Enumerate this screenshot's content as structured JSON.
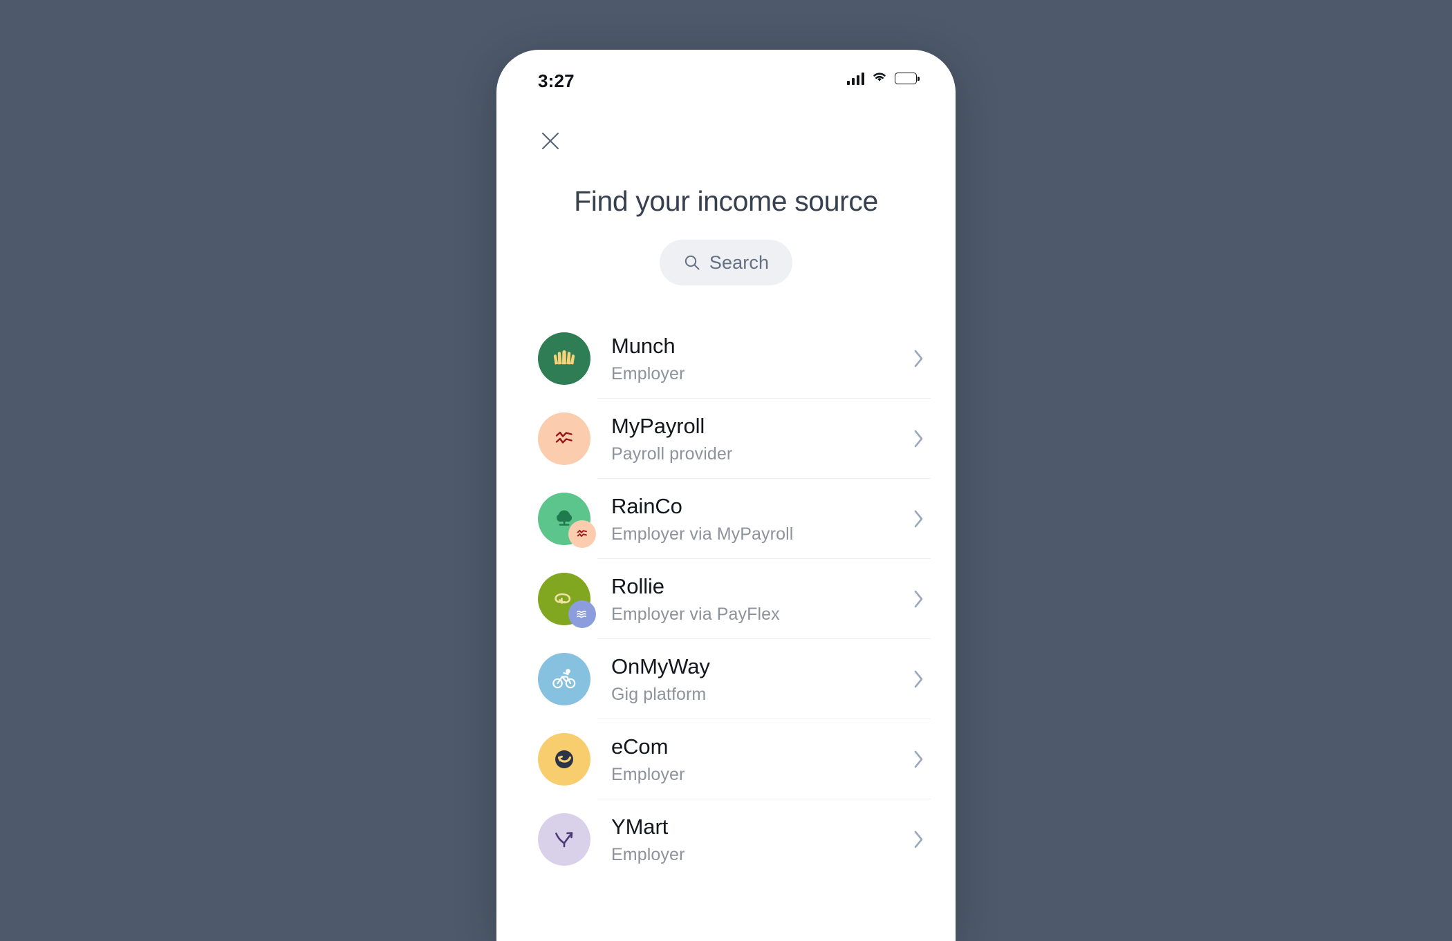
{
  "theme": {
    "backdrop": "#4e5a6b",
    "screen_bg": "#ffffff",
    "title_color": "#37404f",
    "search_bg": "#eef0f3",
    "chevron_color": "#9aa7bd",
    "divider": "#edeef1",
    "subtitle_color": "#8d929b"
  },
  "status_bar": {
    "time": "3:27",
    "signal_icon": "cellular-signal-icon",
    "wifi_icon": "wifi-icon",
    "battery_icon": "battery-full-icon"
  },
  "header": {
    "close_icon": "close-icon",
    "title": "Find your income source"
  },
  "search": {
    "icon": "search-icon",
    "placeholder": "Search",
    "value": ""
  },
  "list": {
    "chevron_icon": "chevron-right-icon",
    "items": [
      {
        "name": "Munch",
        "subtitle": "Employer",
        "icon": "munch-fan-icon",
        "avatar_bg": "#2f7d54",
        "glyph_color": "#f6d278",
        "badge": null
      },
      {
        "name": "MyPayroll",
        "subtitle": "Payroll provider",
        "icon": "mypayroll-zigzag-icon",
        "avatar_bg": "#fbcdae",
        "glyph_color": "#9b1418",
        "badge": null
      },
      {
        "name": "RainCo",
        "subtitle": "Employer via MyPayroll",
        "icon": "rainco-tree-icon",
        "avatar_bg": "#5cc58c",
        "glyph_color": "#1f7a4d",
        "badge": {
          "icon": "mypayroll-zigzag-icon",
          "bg": "#fbcdae",
          "glyph_color": "#9b1418"
        }
      },
      {
        "name": "Rollie",
        "subtitle": "Employer via PayFlex",
        "icon": "rollie-loop-arrow-icon",
        "avatar_bg": "#81a61f",
        "glyph_color": "#f1e2a6",
        "badge": {
          "icon": "payflex-waves-icon",
          "bg": "#8b9ddd",
          "glyph_color": "#ffffff"
        }
      },
      {
        "name": "OnMyWay",
        "subtitle": "Gig platform",
        "icon": "onmyway-cyclist-icon",
        "avatar_bg": "#86c1df",
        "glyph_color": "#ffffff",
        "badge": null
      },
      {
        "name": "eCom",
        "subtitle": "Employer",
        "icon": "ecom-smile-arrow-icon",
        "avatar_bg": "#f8cd6e",
        "glyph_color": "#2b3446",
        "badge": null
      },
      {
        "name": "YMart",
        "subtitle": "Employer",
        "icon": "ymart-y-arrow-icon",
        "avatar_bg": "#d9d0ea",
        "glyph_color": "#4e3a77",
        "badge": null
      }
    ]
  }
}
